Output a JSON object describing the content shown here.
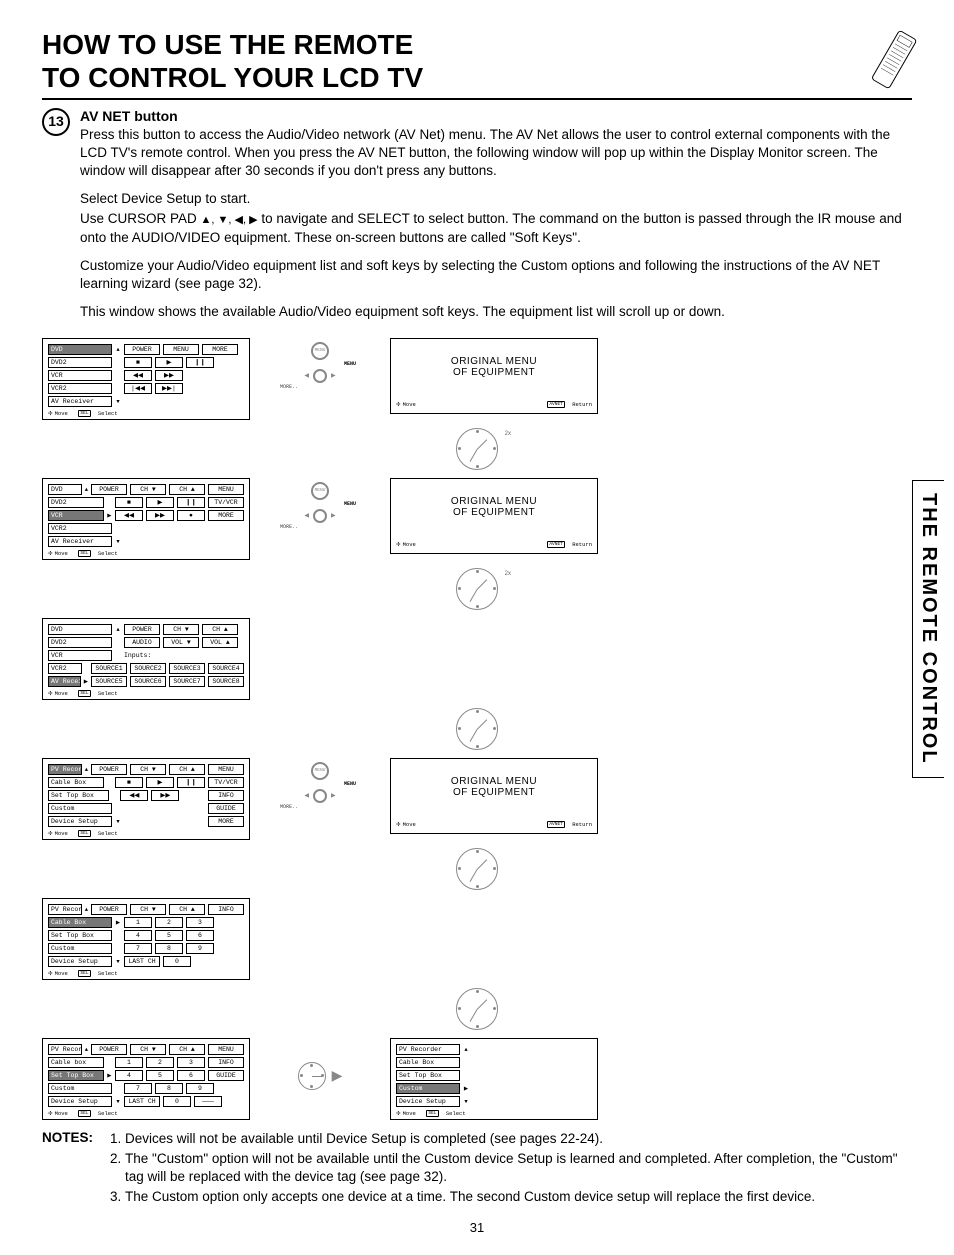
{
  "header": {
    "title_line1": "HOW TO USE THE REMOTE",
    "title_line2": "TO CONTROL YOUR LCD TV"
  },
  "sidebar_tab": "THE REMOTE CONTROL",
  "section": {
    "number": "13",
    "heading": "AV NET button",
    "p1": "Press this button to access the Audio/Video network (AV Net) menu.  The AV Net allows the user to control external components with the LCD TV's remote control.  When you press the AV NET button, the following window will pop up within the Display Monitor screen.  The window will disappear after 30 seconds if you don't press any buttons.",
    "p2": "Select Device Setup to start.",
    "p3_pre": "Use CURSOR PAD ",
    "p3_post": " to navigate and SELECT to select button.  The command on the button is passed through the IR mouse and onto the AUDIO/VIDEO equipment.  These on-screen buttons are called \"Soft Keys\".",
    "p4": "Customize your Audio/Video equipment list and soft keys by selecting the Custom options and following the instructions of the AV NET learning wizard (see page 32).",
    "p5": "This window shows the available Audio/Video equipment soft keys.  The equipment list will scroll up or down."
  },
  "orig_menu_label": {
    "line1": "ORIGINAL MENU",
    "line2": "OF EQUIPMENT"
  },
  "nav_labels": {
    "menu_btn": "MENU",
    "menu_word": "MENU",
    "more": "MORE.."
  },
  "soft": {
    "power": "POWER",
    "menu": "MENU",
    "more": "MORE",
    "ch_down": "CH ▼",
    "ch_up": "CH ▲",
    "tv_vcr": "TV/VCR",
    "info": "INFO",
    "guide": "GUIDE",
    "audio": "AUDIO",
    "vol_down": "VOL ▼",
    "vol_up": "VOL ▲",
    "inputs": "Inputs:",
    "src1": "SOURCE1",
    "src2": "SOURCE2",
    "src3": "SOURCE3",
    "src4": "SOURCE4",
    "src5": "SOURCE5",
    "src6": "SOURCE6",
    "src7": "SOURCE7",
    "src8": "SOURCE8",
    "last_ch": "LAST CH",
    "stop": "■",
    "play": "▶",
    "pause": "❙❙",
    "rew": "◀◀",
    "ff": "▶▶",
    "prev": "|◀◀",
    "next": "▶▶|",
    "rec": "●",
    "n1": "1",
    "n2": "2",
    "n3": "3",
    "n4": "4",
    "n5": "5",
    "n6": "6",
    "n7": "7",
    "n8": "8",
    "n9": "9",
    "n0": "0",
    "dash": "———"
  },
  "devices": {
    "dvd": "DVD",
    "dvd2": "DVD2",
    "vcr": "VCR",
    "vcr2": "VCR2",
    "av_rec": "AV Receiver",
    "pv_rec": "PV Recorder",
    "cable": "Cable Box",
    "cable_lc": "Cable box",
    "stb": "Set Top Box",
    "custom": "Custom",
    "dev_setup": "Device Setup"
  },
  "footer": {
    "move": "Move",
    "select": "Select",
    "sel_pad": "SEL",
    "return": "Return",
    "avnet_pad": "AVNET"
  },
  "clock_label": "2x",
  "notes": {
    "label": "NOTES:",
    "n1": "Devices will not be available until Device Setup is completed (see pages 22-24).",
    "n2": "The \"Custom\" option will not be available until the Custom device Setup is learned and completed.  After completion, the \"Custom\" tag will be replaced with the device tag (see page 32).",
    "n3": "The Custom option only accepts one device at a time.  The second Custom device setup will replace the first device."
  },
  "page_number": "31"
}
